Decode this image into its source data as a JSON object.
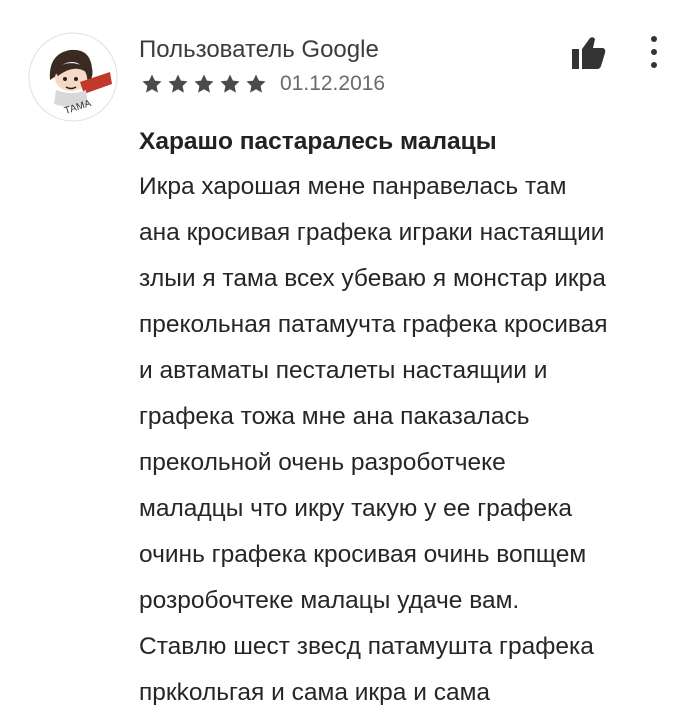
{
  "review": {
    "author": "Пользователь Google",
    "rating": 5,
    "date": "01.12.2016",
    "title": "Харашо пастаралесь малацы",
    "body_lines": [
      "Икра харошая мене панравелась там",
      "ана кросивая графека играки настаящии",
      "злыи я тама всех убеваю я монстар икра",
      "прекольная патамучта графека кросивая",
      "и автаматы песталеты настаящии и",
      "графека тожа мне ана паказалась",
      "прекольной очень разроботчеке",
      "маладцы что икру такую у ее графека",
      "очинь графека кросивая очинь вопщем",
      "розробочтеке малацы удаче вам.",
      "Ставлю шест звесд патамушта графека",
      "пркkольгая и сама икра и сама"
    ]
  },
  "avatar": {
    "caption": "ТАМА"
  },
  "icons": {
    "star": "star-icon",
    "thumb": "thumb-up-icon",
    "more": "more-vert-icon"
  },
  "colors": {
    "star": "#4a4a4a",
    "text": "#222222",
    "date": "#6a6a6a",
    "icon": "#333333"
  }
}
